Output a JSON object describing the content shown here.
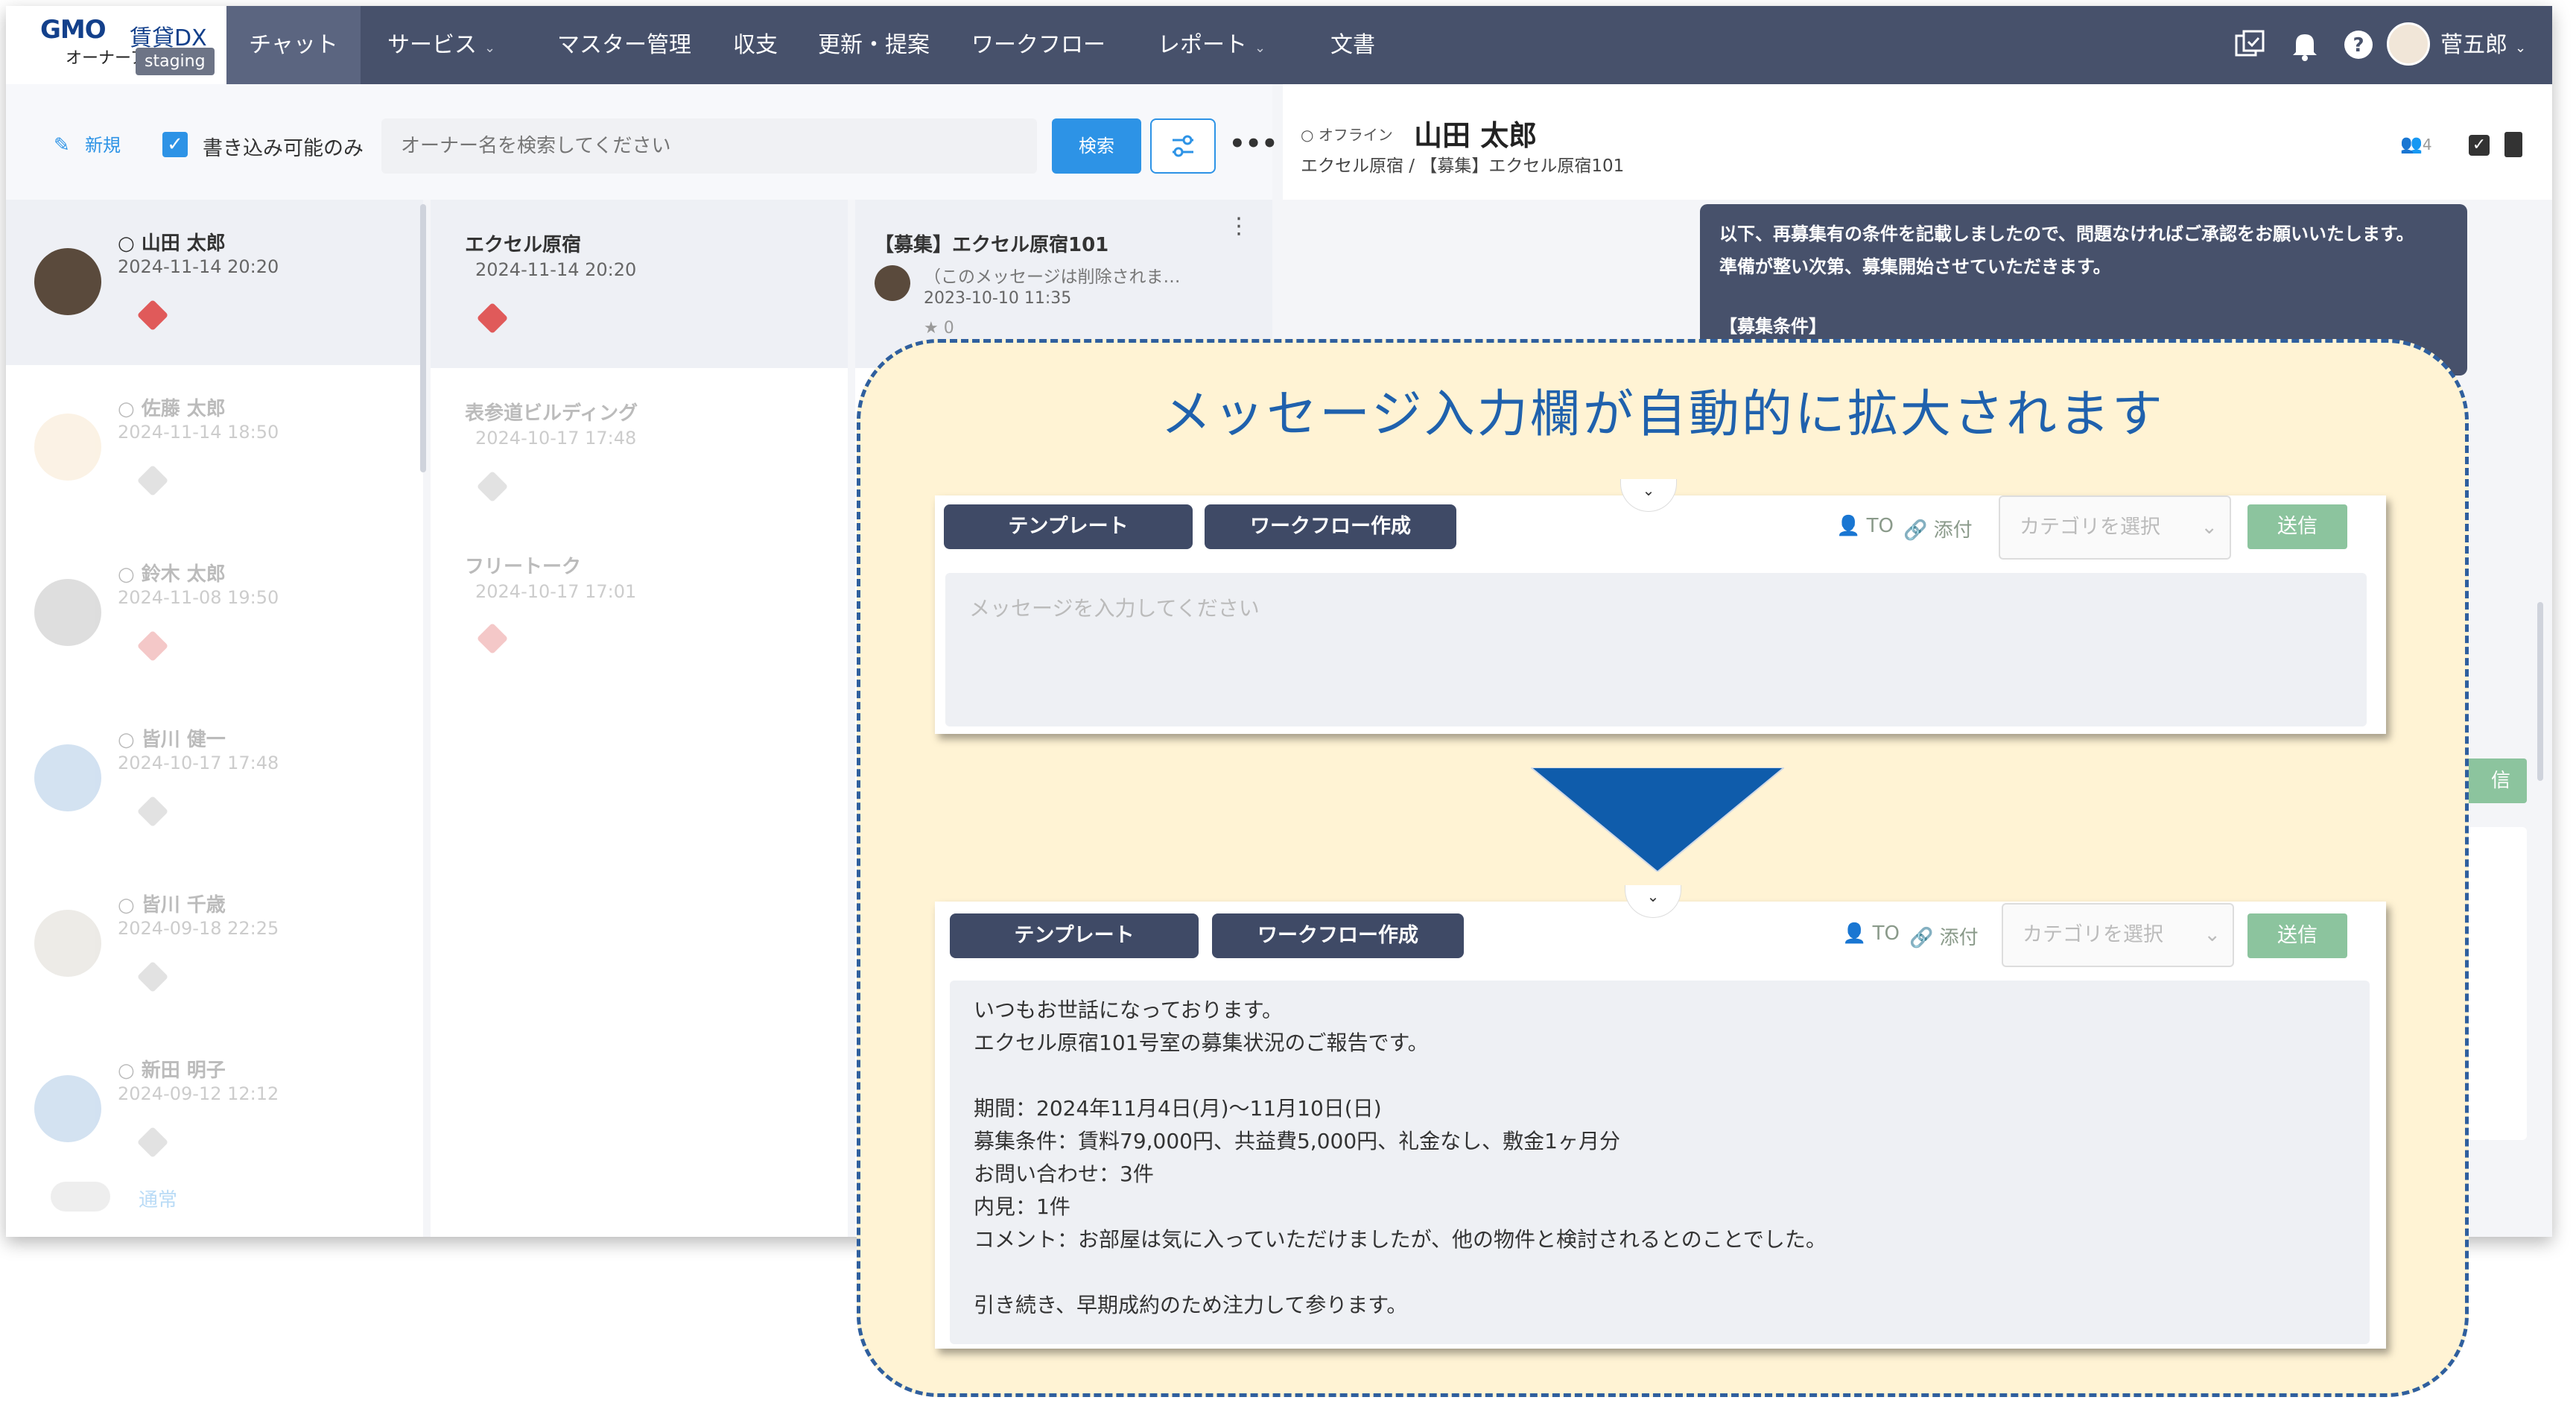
{
  "header": {
    "logo_gmo": "GMO",
    "logo_dx": "賃貸DX",
    "logo_sub": "オーナーア",
    "env_badge": "staging",
    "nav": [
      {
        "label": "チャット"
      },
      {
        "label": "サービス"
      },
      {
        "label": "マスター管理"
      },
      {
        "label": "収支"
      },
      {
        "label": "更新・提案"
      },
      {
        "label": "ワークフロー"
      },
      {
        "label": "レポート"
      },
      {
        "label": "文書"
      }
    ],
    "user_name": "菅五郎"
  },
  "toolbar": {
    "new_label": "新規",
    "writable_only_label": "書き込み可能のみ",
    "search_placeholder": "オーナー名を検索してください",
    "search_button": "検索",
    "more": "•••"
  },
  "chat_header": {
    "status": "オフライン",
    "name": "山田 太郎",
    "breadcrumb": "エクセル原宿 / 【募集】エクセル原宿101",
    "member_count": "4"
  },
  "owners": [
    {
      "name": "山田 太郎",
      "date": "2024-11-14 20:20"
    },
    {
      "name": "佐藤 太郎",
      "date": "2024-11-14 18:50"
    },
    {
      "name": "鈴木 太郎",
      "date": "2024-11-08 19:50"
    },
    {
      "name": "皆川 健一",
      "date": "2024-10-17 17:48"
    },
    {
      "name": "皆川 千歳",
      "date": "2024-09-18 22:25"
    },
    {
      "name": "新田 明子",
      "date": "2024-09-12 12:12"
    }
  ],
  "properties": [
    {
      "name": "エクセル原宿",
      "date": "2024-11-14 20:20"
    },
    {
      "name": "表参道ビルディング",
      "date": "2024-10-17 17:48"
    },
    {
      "name": "フリートーク",
      "date": "2024-10-17 17:01"
    }
  ],
  "room": {
    "title": "【募集】エクセル原宿101",
    "preview": "（このメッセージは削除されま…",
    "date": "2023-10-10 11:35",
    "star_count": "0"
  },
  "bottom_toggle_label": "通常",
  "incoming_message": [
    "以下、再募集有の条件を記載しましたので、問題なければご承認をお願いいたします。",
    "準備が整い次第、募集開始させていただきます。",
    "",
    "【募集条件】"
  ],
  "send_partial": "信",
  "callout": {
    "title": "メッセージ入力欄が自動的に拡大されます",
    "before": {
      "template_btn": "テンプレート",
      "workflow_btn": "ワークフロー作成",
      "to_label": "TO",
      "attach_label": "添付",
      "category_placeholder": "カテゴリを選択",
      "send_btn": "送信",
      "message_placeholder": "メッセージを入力してください"
    },
    "after": {
      "template_btn": "テンプレート",
      "workflow_btn": "ワークフロー作成",
      "to_label": "TO",
      "attach_label": "添付",
      "category_placeholder": "カテゴリを選択",
      "send_btn": "送信",
      "message_lines": [
        "いつもお世話になっております。",
        "エクセル原宿101号室の募集状況のご報告です。",
        "",
        "期間：2024年11月4日(月)～11月10日(日)",
        "募集条件：賃料79,000円、共益費5,000円、礼金なし、敷金1ヶ月分",
        "お問い合わせ：3件",
        "内見：1件",
        "コメント：お部屋は気に入っていただけましたが、他の物件と検討されるとのことでした。",
        "",
        "引き続き、早期成約のため注力して参ります。"
      ]
    }
  },
  "colors": {
    "header_bg": "#47516b",
    "accent_blue": "#2d93e6",
    "send_green": "#8cc49e",
    "callout_bg": "#fff3d4",
    "callout_border": "#2f5f9e",
    "arrow_blue": "#0f5cab",
    "tag_red": "#e05a5a"
  }
}
